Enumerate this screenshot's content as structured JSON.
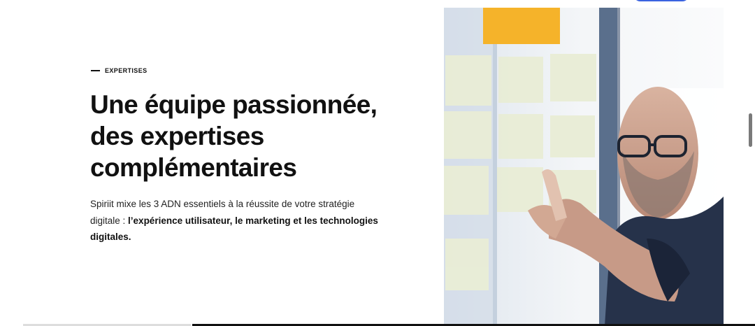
{
  "section": {
    "eyebrow": "EXPERTISES",
    "heading_lines": [
      "Une équipe passionnée,",
      "des expertises",
      "complémentaires"
    ],
    "body_prefix": "Spiriit mixe les 3 ADN essentiels à la réussite de votre stratégie digitale : ",
    "body_bold": "l’expérience utilisateur, le marketing et les technologies digitales."
  },
  "colors": {
    "accent": "#3a63e0",
    "sticky_yellow": "#f5b32a",
    "sticky_pale": "#e9edd6",
    "text": "#111111"
  },
  "image": {
    "icon": "team-photo-sticky-notes"
  }
}
